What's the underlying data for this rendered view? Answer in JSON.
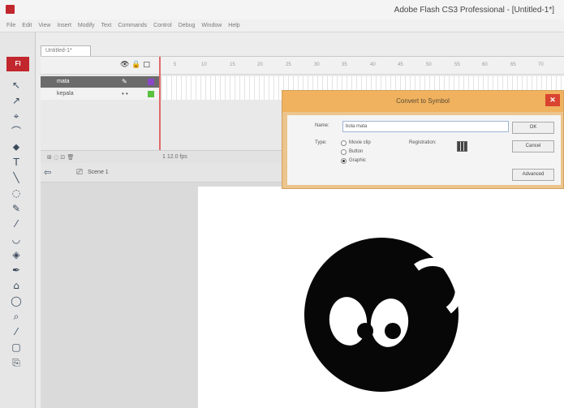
{
  "window": {
    "title": "Adobe Flash CS3 Professional - [Untitled-1*]"
  },
  "menu": [
    "File",
    "Edit",
    "View",
    "Insert",
    "Modify",
    "Text",
    "Commands",
    "Control",
    "Debug",
    "Window",
    "Help"
  ],
  "document": {
    "tab": "Untitled-1*"
  },
  "toolbar": {
    "brand": "Fl",
    "tools": [
      "↖",
      "↗",
      "⌖",
      "⌒",
      "⬥",
      "T",
      "╲",
      "◌",
      "✎",
      "⁄",
      "◡",
      "◈",
      "✒",
      "⌂",
      "◯",
      "⌕",
      "⁄",
      "▢",
      "⎘"
    ]
  },
  "timeline": {
    "header_icons": "👁 🔒 □",
    "ruler": [
      "5",
      "10",
      "15",
      "20",
      "25",
      "30",
      "35",
      "40",
      "45",
      "50",
      "55",
      "60",
      "65",
      "70"
    ],
    "layers": [
      {
        "name": "mata",
        "marks": "✎",
        "color": "#8b47c8"
      },
      {
        "name": "kepala",
        "marks": "• •",
        "color": "#59c23e"
      }
    ],
    "footer_icons": "⊞ ◌ ⊡ 🗑",
    "footer_status": "1   12.0 fps"
  },
  "edit_bar": {
    "scene": "Scene 1"
  },
  "dialog": {
    "title": "Convert to Symbol",
    "name_label": "Name:",
    "name_value": "bola mata",
    "type_label": "Type:",
    "types": [
      "Movie clip",
      "Button",
      "Graphic"
    ],
    "selected_type": "Graphic",
    "registration_label": "Registration:",
    "ok_label": "OK",
    "cancel_label": "Cancel",
    "advanced_label": "Advanced",
    "close_label": "✕"
  }
}
